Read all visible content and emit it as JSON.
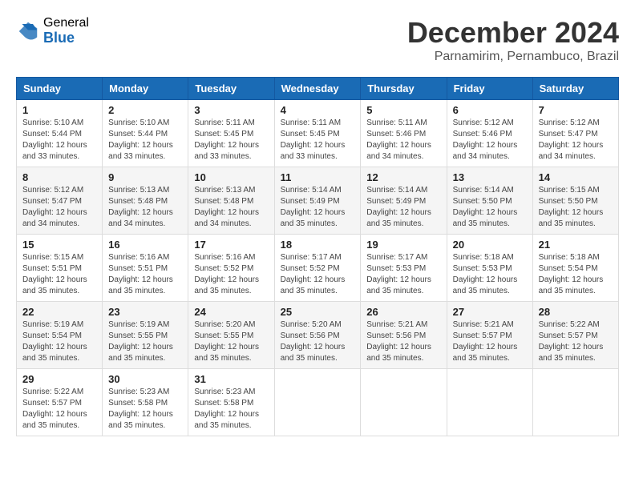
{
  "logo": {
    "general": "General",
    "blue": "Blue"
  },
  "title": "December 2024",
  "subtitle": "Parnamirim, Pernambuco, Brazil",
  "days_of_week": [
    "Sunday",
    "Monday",
    "Tuesday",
    "Wednesday",
    "Thursday",
    "Friday",
    "Saturday"
  ],
  "weeks": [
    [
      {
        "day": "1",
        "sunrise": "Sunrise: 5:10 AM",
        "sunset": "Sunset: 5:44 PM",
        "daylight": "Daylight: 12 hours and 33 minutes."
      },
      {
        "day": "2",
        "sunrise": "Sunrise: 5:10 AM",
        "sunset": "Sunset: 5:44 PM",
        "daylight": "Daylight: 12 hours and 33 minutes."
      },
      {
        "day": "3",
        "sunrise": "Sunrise: 5:11 AM",
        "sunset": "Sunset: 5:45 PM",
        "daylight": "Daylight: 12 hours and 33 minutes."
      },
      {
        "day": "4",
        "sunrise": "Sunrise: 5:11 AM",
        "sunset": "Sunset: 5:45 PM",
        "daylight": "Daylight: 12 hours and 33 minutes."
      },
      {
        "day": "5",
        "sunrise": "Sunrise: 5:11 AM",
        "sunset": "Sunset: 5:46 PM",
        "daylight": "Daylight: 12 hours and 34 minutes."
      },
      {
        "day": "6",
        "sunrise": "Sunrise: 5:12 AM",
        "sunset": "Sunset: 5:46 PM",
        "daylight": "Daylight: 12 hours and 34 minutes."
      },
      {
        "day": "7",
        "sunrise": "Sunrise: 5:12 AM",
        "sunset": "Sunset: 5:47 PM",
        "daylight": "Daylight: 12 hours and 34 minutes."
      }
    ],
    [
      {
        "day": "8",
        "sunrise": "Sunrise: 5:12 AM",
        "sunset": "Sunset: 5:47 PM",
        "daylight": "Daylight: 12 hours and 34 minutes."
      },
      {
        "day": "9",
        "sunrise": "Sunrise: 5:13 AM",
        "sunset": "Sunset: 5:48 PM",
        "daylight": "Daylight: 12 hours and 34 minutes."
      },
      {
        "day": "10",
        "sunrise": "Sunrise: 5:13 AM",
        "sunset": "Sunset: 5:48 PM",
        "daylight": "Daylight: 12 hours and 34 minutes."
      },
      {
        "day": "11",
        "sunrise": "Sunrise: 5:14 AM",
        "sunset": "Sunset: 5:49 PM",
        "daylight": "Daylight: 12 hours and 35 minutes."
      },
      {
        "day": "12",
        "sunrise": "Sunrise: 5:14 AM",
        "sunset": "Sunset: 5:49 PM",
        "daylight": "Daylight: 12 hours and 35 minutes."
      },
      {
        "day": "13",
        "sunrise": "Sunrise: 5:14 AM",
        "sunset": "Sunset: 5:50 PM",
        "daylight": "Daylight: 12 hours and 35 minutes."
      },
      {
        "day": "14",
        "sunrise": "Sunrise: 5:15 AM",
        "sunset": "Sunset: 5:50 PM",
        "daylight": "Daylight: 12 hours and 35 minutes."
      }
    ],
    [
      {
        "day": "15",
        "sunrise": "Sunrise: 5:15 AM",
        "sunset": "Sunset: 5:51 PM",
        "daylight": "Daylight: 12 hours and 35 minutes."
      },
      {
        "day": "16",
        "sunrise": "Sunrise: 5:16 AM",
        "sunset": "Sunset: 5:51 PM",
        "daylight": "Daylight: 12 hours and 35 minutes."
      },
      {
        "day": "17",
        "sunrise": "Sunrise: 5:16 AM",
        "sunset": "Sunset: 5:52 PM",
        "daylight": "Daylight: 12 hours and 35 minutes."
      },
      {
        "day": "18",
        "sunrise": "Sunrise: 5:17 AM",
        "sunset": "Sunset: 5:52 PM",
        "daylight": "Daylight: 12 hours and 35 minutes."
      },
      {
        "day": "19",
        "sunrise": "Sunrise: 5:17 AM",
        "sunset": "Sunset: 5:53 PM",
        "daylight": "Daylight: 12 hours and 35 minutes."
      },
      {
        "day": "20",
        "sunrise": "Sunrise: 5:18 AM",
        "sunset": "Sunset: 5:53 PM",
        "daylight": "Daylight: 12 hours and 35 minutes."
      },
      {
        "day": "21",
        "sunrise": "Sunrise: 5:18 AM",
        "sunset": "Sunset: 5:54 PM",
        "daylight": "Daylight: 12 hours and 35 minutes."
      }
    ],
    [
      {
        "day": "22",
        "sunrise": "Sunrise: 5:19 AM",
        "sunset": "Sunset: 5:54 PM",
        "daylight": "Daylight: 12 hours and 35 minutes."
      },
      {
        "day": "23",
        "sunrise": "Sunrise: 5:19 AM",
        "sunset": "Sunset: 5:55 PM",
        "daylight": "Daylight: 12 hours and 35 minutes."
      },
      {
        "day": "24",
        "sunrise": "Sunrise: 5:20 AM",
        "sunset": "Sunset: 5:55 PM",
        "daylight": "Daylight: 12 hours and 35 minutes."
      },
      {
        "day": "25",
        "sunrise": "Sunrise: 5:20 AM",
        "sunset": "Sunset: 5:56 PM",
        "daylight": "Daylight: 12 hours and 35 minutes."
      },
      {
        "day": "26",
        "sunrise": "Sunrise: 5:21 AM",
        "sunset": "Sunset: 5:56 PM",
        "daylight": "Daylight: 12 hours and 35 minutes."
      },
      {
        "day": "27",
        "sunrise": "Sunrise: 5:21 AM",
        "sunset": "Sunset: 5:57 PM",
        "daylight": "Daylight: 12 hours and 35 minutes."
      },
      {
        "day": "28",
        "sunrise": "Sunrise: 5:22 AM",
        "sunset": "Sunset: 5:57 PM",
        "daylight": "Daylight: 12 hours and 35 minutes."
      }
    ],
    [
      {
        "day": "29",
        "sunrise": "Sunrise: 5:22 AM",
        "sunset": "Sunset: 5:57 PM",
        "daylight": "Daylight: 12 hours and 35 minutes."
      },
      {
        "day": "30",
        "sunrise": "Sunrise: 5:23 AM",
        "sunset": "Sunset: 5:58 PM",
        "daylight": "Daylight: 12 hours and 35 minutes."
      },
      {
        "day": "31",
        "sunrise": "Sunrise: 5:23 AM",
        "sunset": "Sunset: 5:58 PM",
        "daylight": "Daylight: 12 hours and 35 minutes."
      },
      null,
      null,
      null,
      null
    ]
  ]
}
